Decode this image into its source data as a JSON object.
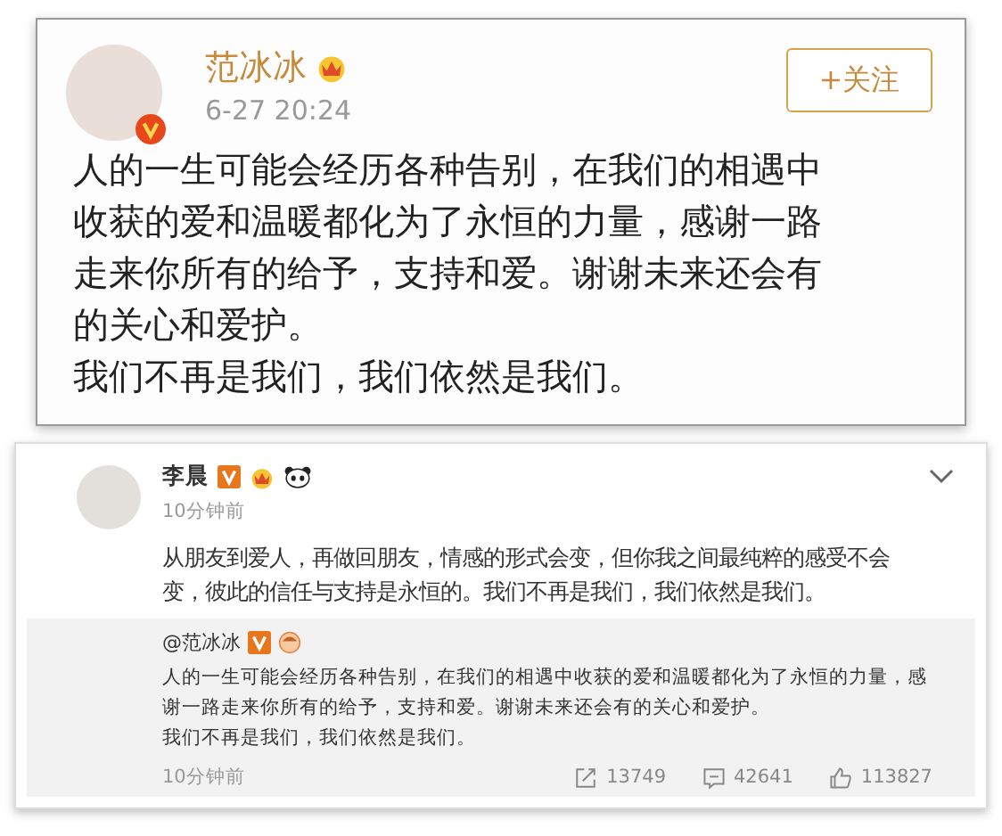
{
  "post": {
    "author": "范冰冰",
    "time": "6-27 20:24",
    "follow_button": "+关注",
    "paragraphs": [
      "人的一生可能会经历各种告别，在我们的相遇中收获的爱和温暖都化为了永恒的力量，感谢一路走来你所有的给予，支持和爱。谢谢未来还会有的关心和爱护。",
      "我们不再是我们，我们依然是我们。"
    ]
  },
  "reply": {
    "author": "李晨",
    "time": "10分钟前",
    "text": "从朋友到爱人，再做回朋友，情感的形式会变，但你我之间最纯粹的感受不会变，彼此的信任与支持是永恒的。我们不再是我们，我们依然是我们。",
    "quote": {
      "author": "@范冰冰",
      "paragraphs": [
        "人的一生可能会经历各种告别，在我们的相遇中收获的爱和温暖都化为了永恒的力量，感谢一路走来你所有的给予，支持和爱。谢谢未来还会有的关心和爱护。",
        "我们不再是我们，我们依然是我们。"
      ],
      "time": "10分钟前",
      "actions": [
        {
          "kind": "share",
          "count": "13749"
        },
        {
          "kind": "comment",
          "count": "42641"
        },
        {
          "kind": "like",
          "count": "113827"
        }
      ]
    }
  }
}
